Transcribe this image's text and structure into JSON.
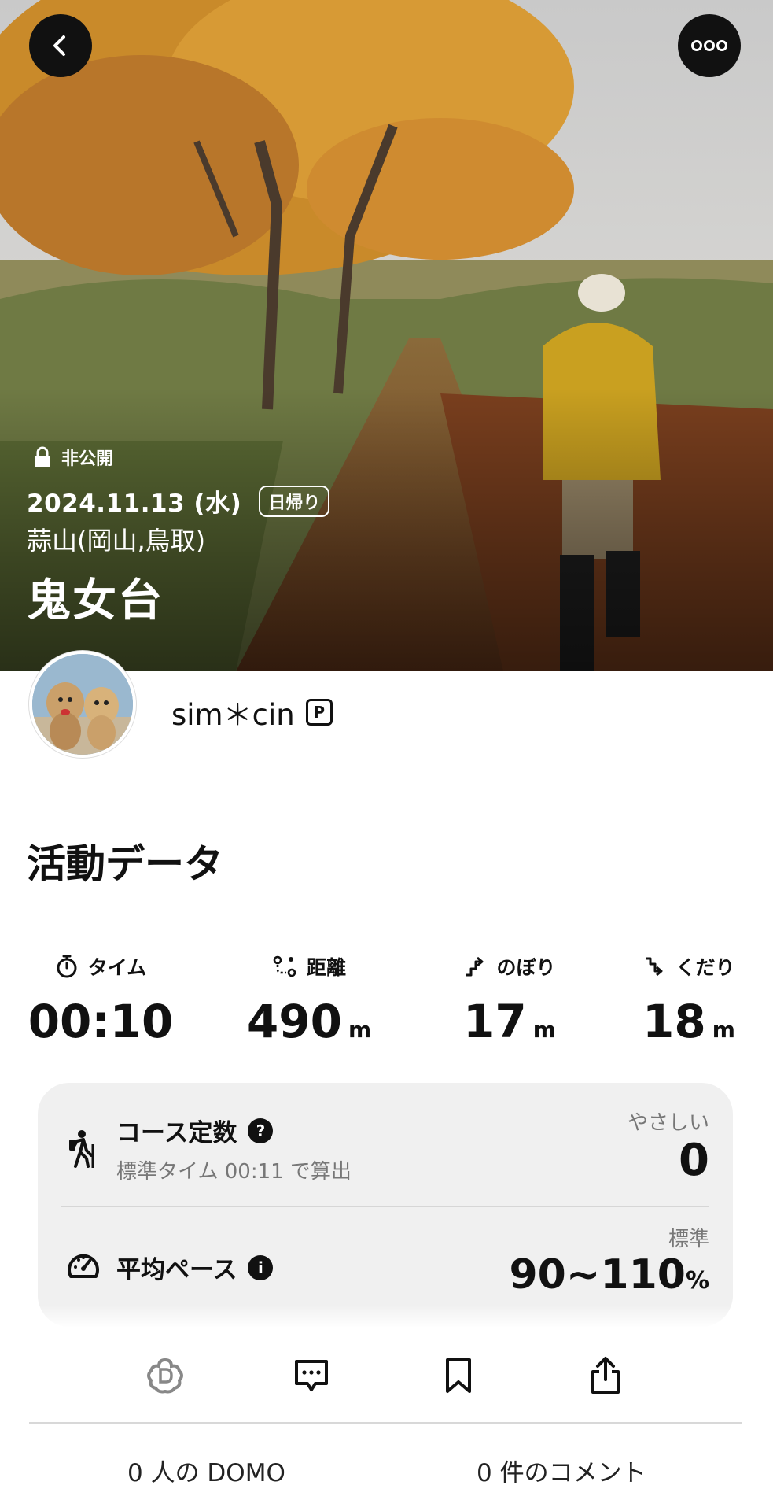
{
  "header": {
    "privacy_label": "非公開",
    "date": "2024.11.13 (水)",
    "trip_type": "日帰り",
    "location": "蒜山(岡山,鳥取)",
    "title": "鬼女台"
  },
  "user": {
    "name": "sim＊cin",
    "premium_badge": "P"
  },
  "activity": {
    "section_title": "活動データ",
    "stats": [
      {
        "label": "タイム",
        "value": "00:10",
        "unit": ""
      },
      {
        "label": "距離",
        "value": "490",
        "unit": "m"
      },
      {
        "label": "のぼり",
        "value": "17",
        "unit": "m"
      },
      {
        "label": "くだり",
        "value": "18",
        "unit": "m"
      }
    ]
  },
  "course": {
    "title": "コース定数",
    "help_icon": "?",
    "subtitle": "標準タイム 00:11 で算出",
    "level": "やさしい",
    "value": "0"
  },
  "pace": {
    "title": "平均ペース",
    "info_icon": "i",
    "level": "標準",
    "value": "90~110",
    "unit": "%"
  },
  "footer": {
    "domo_count": "0 人の DOMO",
    "comment_count": "0 件のコメント"
  },
  "icons": {
    "back": "back-arrow-icon",
    "more": "more-dots-icon",
    "lock": "lock-icon",
    "timer": "stopwatch-icon",
    "distance": "route-icon",
    "ascent": "ascent-arrow-icon",
    "descent": "descent-arrow-icon",
    "hiker": "hiker-icon",
    "pace": "speedometer-icon",
    "domo": "domo-flower-icon",
    "comment": "comment-icon",
    "bookmark": "bookmark-icon",
    "share": "share-icon"
  },
  "colors": {
    "accent": "#111111",
    "card_bg": "#f0f0f0",
    "muted_text": "#777777"
  }
}
